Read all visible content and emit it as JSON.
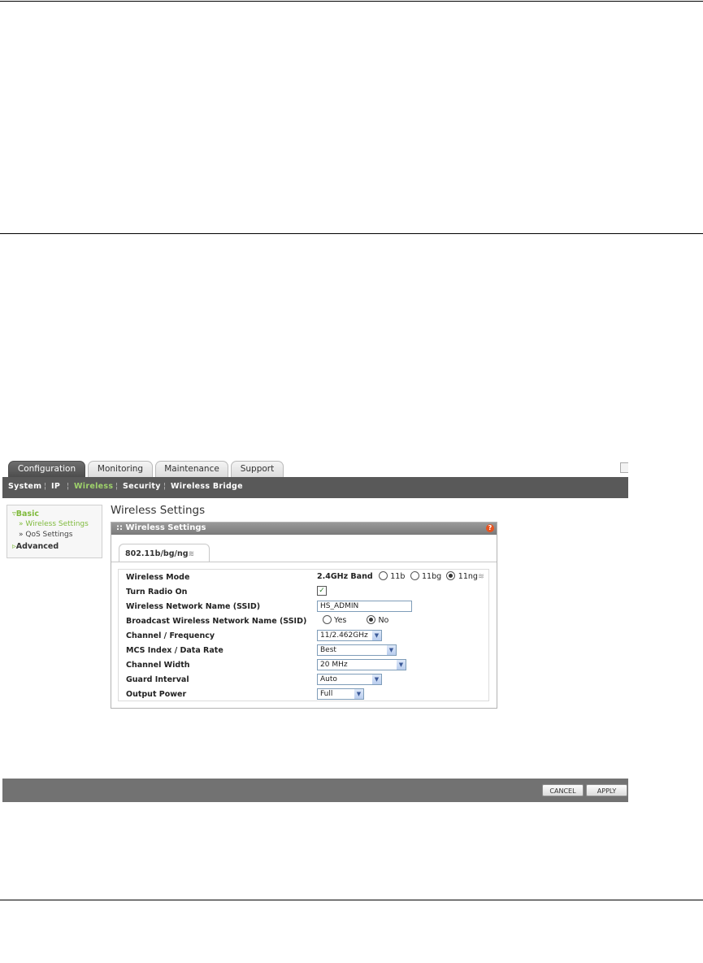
{
  "tabs": [
    {
      "label": "Configuration",
      "active": true
    },
    {
      "label": "Monitoring",
      "active": false
    },
    {
      "label": "Maintenance",
      "active": false
    },
    {
      "label": "Support",
      "active": false
    }
  ],
  "subnav": [
    {
      "label": "System",
      "active": false
    },
    {
      "label": "IP",
      "active": false
    },
    {
      "label": "Wireless",
      "active": true
    },
    {
      "label": "Security",
      "active": false
    },
    {
      "label": "Wireless Bridge",
      "active": false
    }
  ],
  "sidebar": {
    "basic": "Basic",
    "wireless_settings": "Wireless Settings",
    "qos_settings": "QoS Settings",
    "advanced": "Advanced"
  },
  "page_title": "Wireless Settings",
  "panel": {
    "title": "Wireless Settings",
    "help_icon": "?",
    "tab_label": "802.11b/bg/ng"
  },
  "form": {
    "wireless_mode": {
      "label": "Wireless Mode",
      "band": "2.4GHz Band",
      "options": [
        "11b",
        "11bg",
        "11ng"
      ],
      "selected": "11ng"
    },
    "turn_radio_on": {
      "label": "Turn Radio On",
      "checked": true
    },
    "ssid": {
      "label": "Wireless Network Name (SSID)",
      "value": "HS_ADMIN"
    },
    "broadcast": {
      "label": "Broadcast Wireless Network Name (SSID)",
      "yes": "Yes",
      "no": "No",
      "selected": "No"
    },
    "channel": {
      "label": "Channel / Frequency",
      "value": "11/2.462GHz"
    },
    "mcs": {
      "label": "MCS Index / Data Rate",
      "value": "Best"
    },
    "channel_width": {
      "label": "Channel Width",
      "value": "20 MHz"
    },
    "guard_interval": {
      "label": "Guard Interval",
      "value": "Auto"
    },
    "output_power": {
      "label": "Output Power",
      "value": "Full"
    }
  },
  "buttons": {
    "cancel": "CANCEL",
    "apply": "APPLY"
  },
  "colors": {
    "accent_green": "#7fba3c",
    "nav_bg": "#595959",
    "footer_bg": "#727272",
    "help_icon": "#e8531f"
  }
}
